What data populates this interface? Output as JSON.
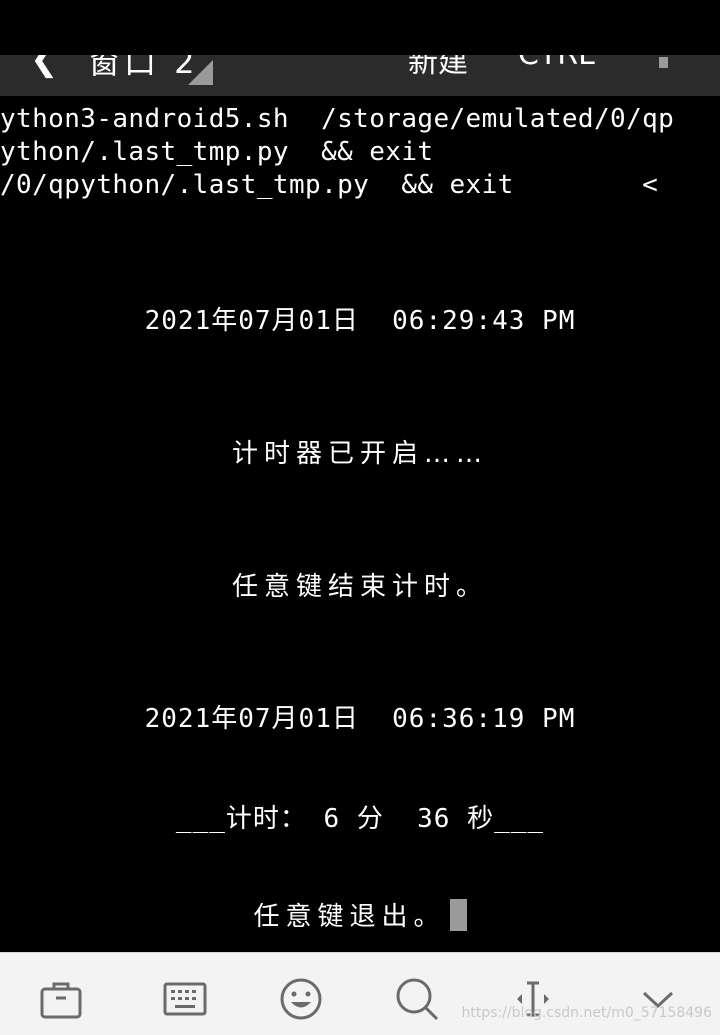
{
  "topbar": {
    "back_icon": "chevron-left-icon",
    "session_label": "窗口 2",
    "new_label": "新建",
    "ctrl_label": "CTRL",
    "menu_icon": "overflow-menu-icon"
  },
  "terminal": {
    "lines": [
      "ython3-android5.sh  /storage/emulated/0/qp",
      "ython/.last_tmp.py  && exit",
      "/0/qpython/.last_tmp.py  && exit        <"
    ],
    "start_time": "2021年07月01日  06:29:43 PM",
    "timer_started": "计时器已开启……",
    "press_to_stop": "任意键结束计时。",
    "end_time": "2021年07月01日  06:36:19 PM",
    "elapsed": "___计时： 6 分  36 秒___",
    "press_to_exit": "任意键退出。"
  },
  "toolbar": {
    "items": [
      {
        "icon": "briefcase-icon"
      },
      {
        "icon": "keyboard-icon"
      },
      {
        "icon": "emoji-icon"
      },
      {
        "icon": "search-icon"
      },
      {
        "icon": "text-cursor-icon"
      },
      {
        "icon": "chevron-down-icon"
      }
    ],
    "watermark": "https://blog.csdn.net/m0_57158496"
  },
  "colors": {
    "terminal_bg": "#000000",
    "terminal_fg": "#ffffff",
    "toolbar_bg": "#f3f3f3",
    "icon_color": "#6b6b6b"
  }
}
